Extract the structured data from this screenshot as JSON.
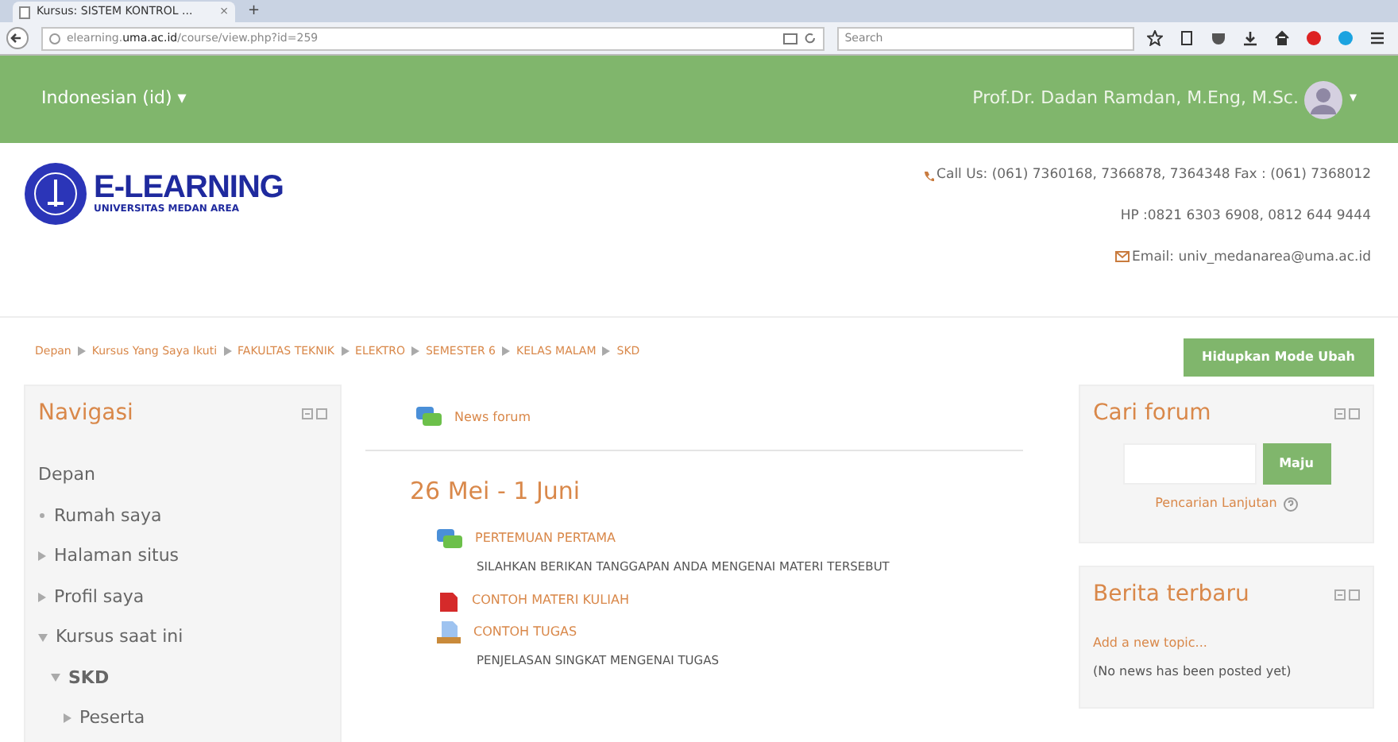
{
  "browser": {
    "tab_title": "Kursus: SISTEM KONTROL ...",
    "tab_close": "×",
    "new_tab": "+",
    "url_prefix": "elearning.",
    "url_domain": "uma.ac.id",
    "url_path": "/course/view.php?id=259",
    "search_placeholder": "Search"
  },
  "topbar": {
    "language": "Indonesian (id) ▾",
    "user": "Prof.Dr. Dadan Ramdan, M.Eng, M.Sc.",
    "user_caret": "▾"
  },
  "header": {
    "logo_title": "E-LEARNING",
    "logo_subtitle": "UNIVERSITAS MEDAN AREA",
    "contacts": [
      {
        "kind": "phone",
        "text": "Call Us: (061) 7360168, 7366878, 7364348 Fax : (061) 7368012"
      },
      {
        "kind": "plain",
        "text": "HP :0821 6303 6908, 0812 644 9444"
      },
      {
        "kind": "mail",
        "text": "Email: univ_medanarea@uma.ac.id"
      }
    ]
  },
  "breadcrumb": [
    "Depan",
    "Kursus Yang Saya Ikuti",
    "FAKULTAS TEKNIK",
    "ELEKTRO",
    "SEMESTER 6",
    "KELAS MALAM",
    "SKD"
  ],
  "edit_button": "Hidupkan Mode Ubah",
  "navigation": {
    "title": "Navigasi",
    "items": [
      {
        "label": "Depan",
        "kind": "plain"
      },
      {
        "label": "Rumah saya",
        "kind": "bullet"
      },
      {
        "label": "Halaman situs",
        "kind": "node",
        "expanded": false
      },
      {
        "label": "Profil saya",
        "kind": "node",
        "expanded": false
      },
      {
        "label": "Kursus saat ini",
        "kind": "node",
        "expanded": true,
        "children": [
          {
            "label": "SKD",
            "kind": "node",
            "expanded": true,
            "children": [
              {
                "label": "Peserta",
                "kind": "node",
                "expanded": false
              }
            ]
          }
        ]
      }
    ]
  },
  "main": {
    "top_activity": {
      "kind": "forum",
      "label": "News forum"
    },
    "section_title": "26 Mei - 1 Juni",
    "activities": [
      {
        "kind": "forum",
        "label": "PERTEMUAN PERTAMA",
        "description": "SILAHKAN BERIKAN TANGGAPAN ANDA MENGENAI MATERI TERSEBUT"
      },
      {
        "kind": "file",
        "label": "CONTOH MATERI KULIAH"
      },
      {
        "kind": "assignment",
        "label": "CONTOH TUGAS",
        "description": "PENJELASAN SINGKAT MENGENAI TUGAS"
      }
    ]
  },
  "search_forum": {
    "title": "Cari forum",
    "button": "Maju",
    "advanced": "Pencarian Lanjutan"
  },
  "news": {
    "title": "Berita terbaru",
    "add_link": "Add a new topic...",
    "empty": "(No news has been posted yet)"
  }
}
